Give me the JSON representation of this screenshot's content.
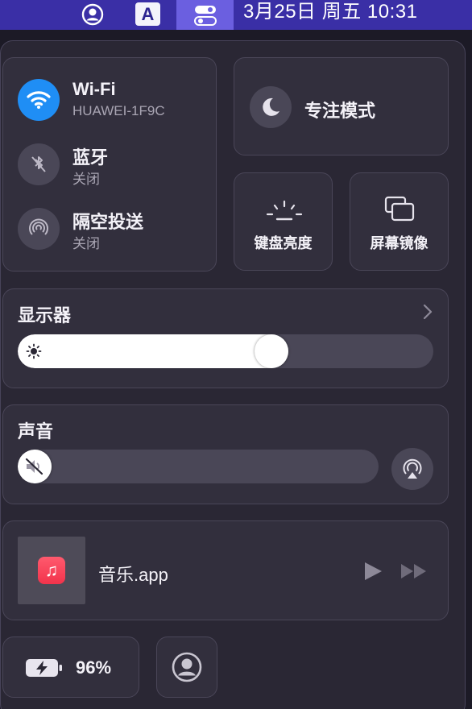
{
  "menubar": {
    "input_letter": "A",
    "clock": "3月25日 周五  10:31"
  },
  "wifi": {
    "title": "Wi-Fi",
    "network": "HUAWEI-1F9C",
    "accent": "#1f8ef5"
  },
  "bluetooth": {
    "title": "蓝牙",
    "status": "关闭"
  },
  "airdrop": {
    "title": "隔空投送",
    "status": "关闭"
  },
  "focus": {
    "label": "专注模式"
  },
  "keyboard_brightness": {
    "label": "键盘亮度"
  },
  "screen_mirroring": {
    "label": "屏幕镜像"
  },
  "display": {
    "title": "显示器",
    "brightness_fraction": 0.62
  },
  "sound": {
    "title": "声音",
    "volume_fraction": 0.0
  },
  "now_playing": {
    "app": "音乐.app",
    "music_glyph": "♫"
  },
  "battery": {
    "percent": "96%"
  },
  "icons": [
    "user-icon",
    "input-source-icon",
    "control-center-icon",
    "wifi-icon",
    "bluetooth-off-icon",
    "airdrop-icon",
    "moon-icon",
    "keyboard-brightness-icon",
    "screen-mirroring-icon",
    "chevron-right-icon",
    "sun-icon",
    "speaker-muted-icon",
    "airplay-audio-icon",
    "music-app-icon",
    "play-icon",
    "fast-forward-icon",
    "battery-charging-icon"
  ]
}
